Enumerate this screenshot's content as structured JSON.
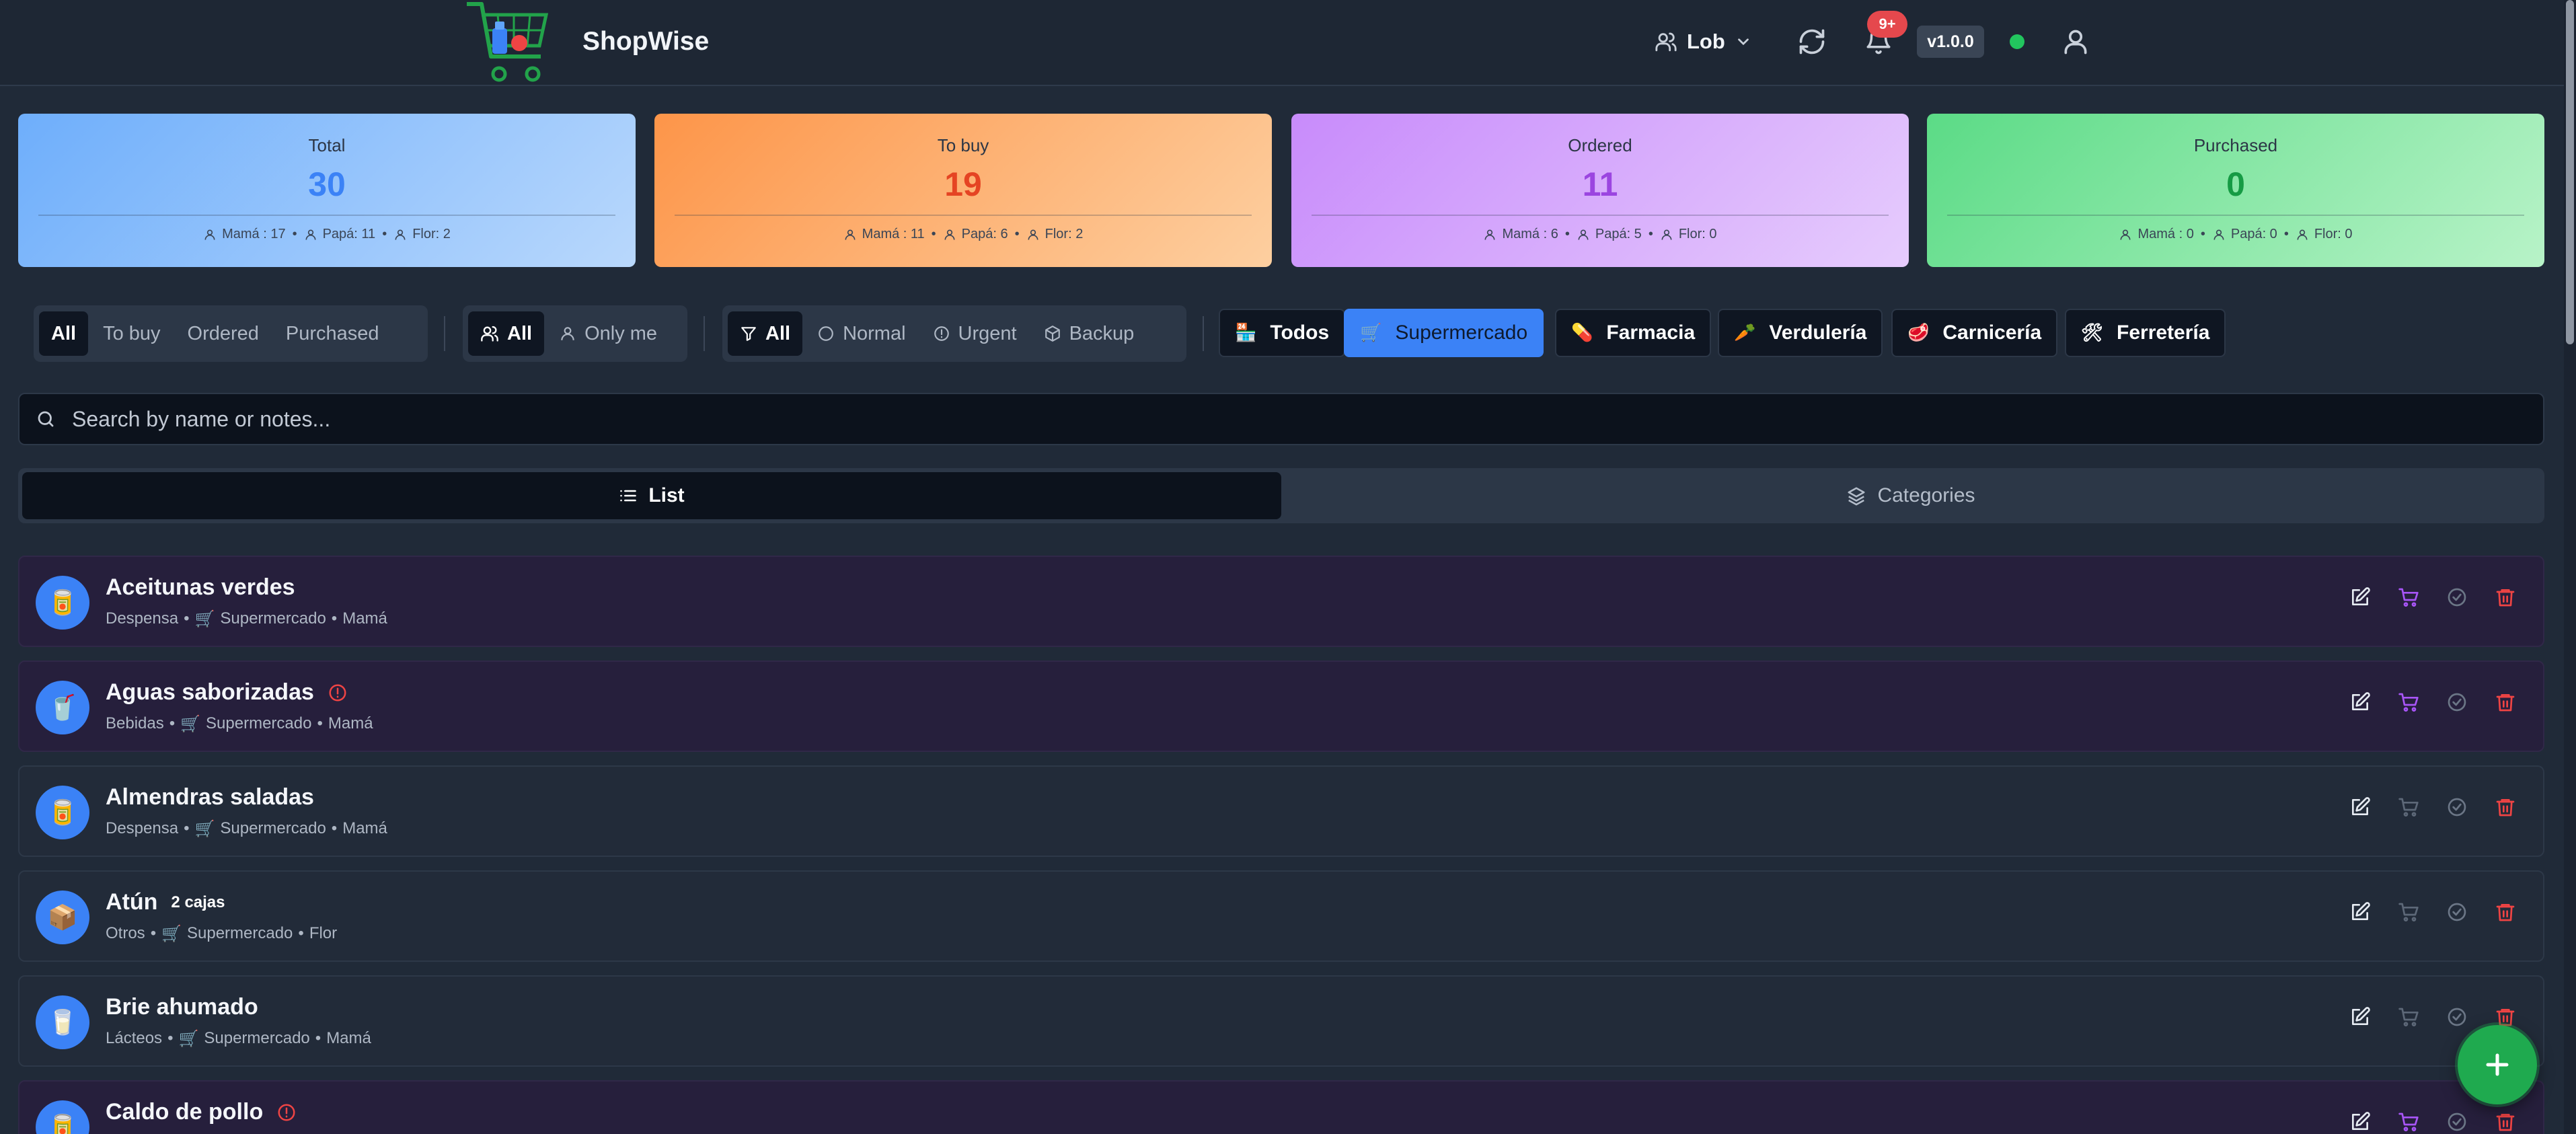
{
  "app": {
    "name": "ShopWise",
    "version": "v1.0.0",
    "notif_badge": "9+",
    "user": "Lob"
  },
  "stats": [
    {
      "title": "Total",
      "value": "30",
      "breakdown": [
        "Mamá : 17",
        "Papá: 11",
        "Flor: 2"
      ]
    },
    {
      "title": "To buy",
      "value": "19",
      "breakdown": [
        "Mamá : 11",
        "Papá: 6",
        "Flor: 2"
      ]
    },
    {
      "title": "Ordered",
      "value": "11",
      "breakdown": [
        "Mamá : 6",
        "Papá: 5",
        "Flor: 0"
      ]
    },
    {
      "title": "Purchased",
      "value": "0",
      "breakdown": [
        "Mamá : 0",
        "Papá: 0",
        "Flor: 0"
      ]
    }
  ],
  "filters": {
    "status": [
      "All",
      "To buy",
      "Ordered",
      "Purchased"
    ],
    "owner": [
      "All",
      "Only me"
    ],
    "priority": [
      "All",
      "Normal",
      "Urgent",
      "Backup"
    ]
  },
  "stores": [
    {
      "label": "Todos",
      "emoji": "🏪"
    },
    {
      "label": "Supermercado",
      "emoji": "🛒"
    },
    {
      "label": "Farmacia",
      "emoji": "💊"
    },
    {
      "label": "Verdulería",
      "emoji": "🥕"
    },
    {
      "label": "Carnicería",
      "emoji": "🥩"
    },
    {
      "label": "Ferretería",
      "emoji": "🛠"
    }
  ],
  "search": {
    "placeholder": "Search by name or notes..."
  },
  "view_toggle": {
    "list": "List",
    "categories": "Categories"
  },
  "items": [
    {
      "name": "Aceitunas verdes",
      "emoji": "🥫",
      "category": "Despensa",
      "store_emoji": "🛒",
      "store": "Supermercado",
      "owner": "Mamá",
      "urgent": false,
      "qty": ""
    },
    {
      "name": "Aguas saborizadas",
      "emoji": "🥤",
      "category": "Bebidas",
      "store_emoji": "🛒",
      "store": "Supermercado",
      "owner": "Mamá",
      "urgent": true,
      "qty": ""
    },
    {
      "name": "Almendras saladas",
      "emoji": "🥫",
      "category": "Despensa",
      "store_emoji": "🛒",
      "store": "Supermercado",
      "owner": "Mamá",
      "urgent": false,
      "qty": ""
    },
    {
      "name": "Atún",
      "emoji": "📦",
      "category": "Otros",
      "store_emoji": "🛒",
      "store": "Supermercado",
      "owner": "Flor",
      "urgent": false,
      "qty": "2 cajas"
    },
    {
      "name": "Brie ahumado",
      "emoji": "🥛",
      "category": "Lácteos",
      "store_emoji": "🛒",
      "store": "Supermercado",
      "owner": "Mamá",
      "urgent": false,
      "qty": ""
    },
    {
      "name": "Caldo de pollo",
      "emoji": "🥫",
      "category": "",
      "store_emoji": "",
      "store": "",
      "owner": "",
      "urgent": true,
      "qty": ""
    }
  ],
  "colors": {
    "accent": "#3b82f6",
    "urgent": "#ef4444",
    "ordered_cart": "#a855f7",
    "fab": "#1faa4f"
  }
}
